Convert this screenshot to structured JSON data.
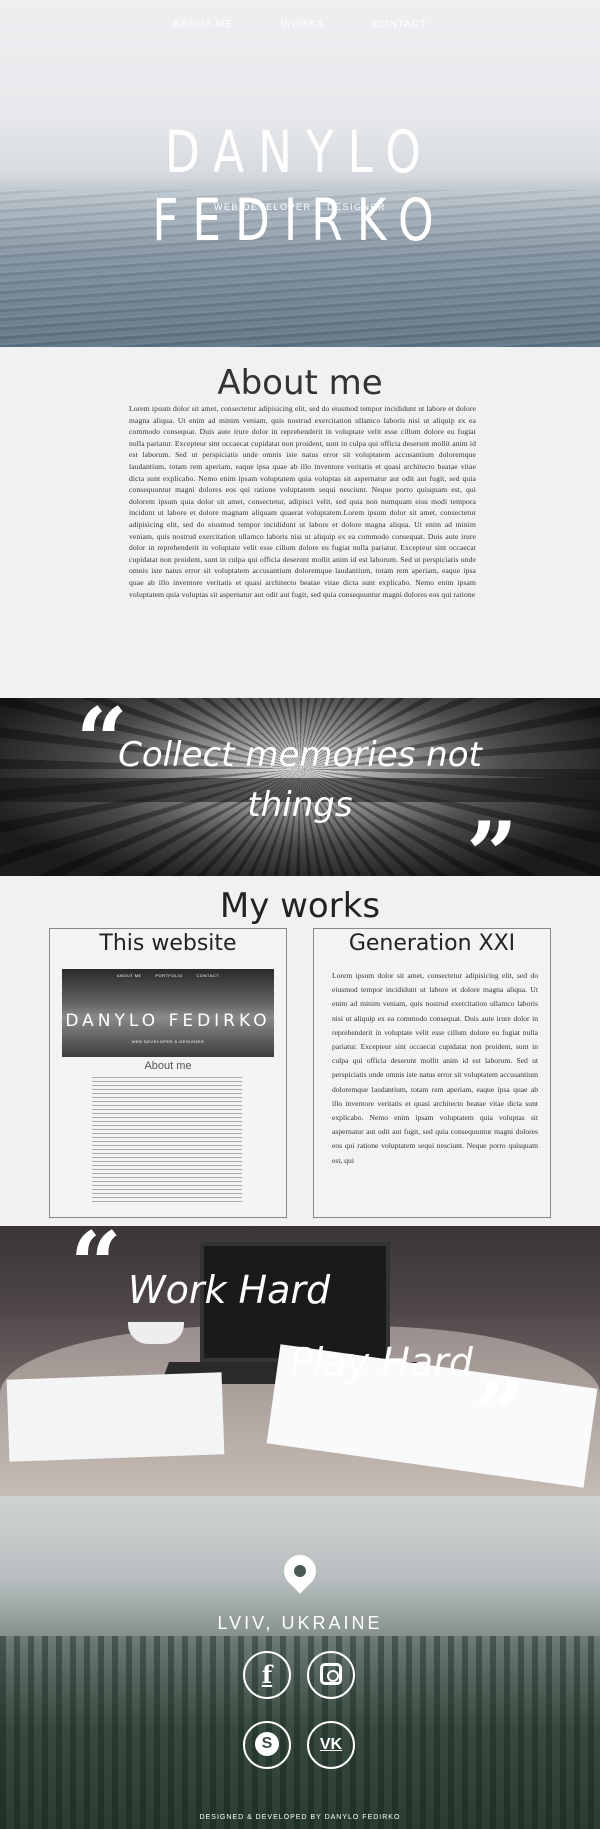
{
  "nav": {
    "about": "ABOUT ME",
    "works": "WORKS",
    "contact": "CONTACT"
  },
  "hero": {
    "title": "DANYLO FEDIRKO",
    "subtitle": "WEB DEVELOPER & DESIGNER"
  },
  "about": {
    "heading": "About me",
    "text": "Lorem ipsum dolor sit amet, consectetur adipisicing elit, sed do eiusmod tempor incididunt ut labore et dolore magna aliqua. Ut enim ad minim veniam, quis nostrud exercitation ullamco laboris nisi ut aliquip ex ea commodo consequat. Duis aute irure dolor in reprehenderit in voluptate velit esse cillum dolore eu fugiat nulla pariatur. Excepteur sint occaecat cupidatat non proident, sunt in culpa qui officia deserunt mollit anim id est laborum. Sed ut perspiciatis unde omnis iste natus error sit voluptatem accusantium doloremque laudantium, totam rem aperiam, eaque ipsa quae ab illo inventore veritatis et quasi architecto beatae vitae dicta sunt explicabo. Nemo enim ipsam voluptatem quia voluptas sit aspernatur aut odit aut fugit, sed quia consequuntur magni dolores eos qui ratione voluptatem sequi nesciunt. Neque porro quisquam est, qui dolorem ipsum quia dolor sit amet, consectetur, adipisci velit, sed quia non numquam eius modi tempora incidunt ut labore et dolore magnam aliquam quaerat voluptatem.Lorem ipsum dolor sit amet, consectetur adipisicing elit, sed do eiusmod tempor incididunt ut labore et dolore magna aliqua. Ut enim ad minim veniam, quis nostrud exercitation ullamco laboris nisi ut aliquip ex ea commodo consequat. Duis aute irure dolor in reprehenderit in voluptate velit esse cillum dolore eu fugiat nulla pariatur. Excepteur sint occaecat cupidatat non proident, sunt in culpa qui officia deserunt mollit anim id est laborum. Sed ut perspiciatis unde omnis iste natus error sit voluptatem accusantium doloremque laudantium, totam rem aperiam, eaque ipsa quae ab illo inventore veritatis et quasi architecto beatae vitae dicta sunt explicabo. Nemo enim ipsam voluptatem quia voluptas sit aspernatur aut odit aut fugit, sed quia consequuntur magni dolores eos qui ratione"
  },
  "quote1": {
    "line1": "Collect memories not",
    "line2": "things",
    "open": "“",
    "close": "”"
  },
  "works": {
    "heading": "My works",
    "card1": {
      "title": "This website",
      "thumb_nav": [
        "ABOUT ME",
        "PORTFOLIO",
        "CONTACT"
      ],
      "thumb_title": "DANYLO FEDIRKO",
      "thumb_subtitle": "WEB DEVELOPER & DESIGNER",
      "thumb_about": "About me"
    },
    "card2": {
      "title": "Generation XXI",
      "text": "Lorem ipsum dolor sit amet, consectetur adipisicing elit, sed do eiusmod tempor incididunt ut labore et dolore magna aliqua. Ut enim ad minim veniam, quis nostrud exercitation ullamco laboris nisi ut aliquip ex ea commodo consequat. Duis aute irure dolor in reprehenderit in voluptate velit esse cillum dolore eu fugiat nulla pariatur. Excepteur sint occaecat cupidatat non proident, sunt in culpa qui officia deserunt mollit anim id est laborum. Sed ut perspiciatis unde omnis iste natus error sit voluptatem accusantium doloremque laudantium, totam rem aperiam, eaque ipsa quae ab illo inventore veritatis et quasi architecto beatae vitae dicta sunt explicabo. Nemo enim ipsam voluptatem quia voluptas sit aspernatur aut odit aut fugit, sed quia consequuntur magni dolores eos qui ratione voluptatem sequi nesciunt. Neque porro quisquam est, qui"
    }
  },
  "quote2": {
    "line1": "Work Hard",
    "line2": "Play Hard",
    "open": "“",
    "close": "”"
  },
  "footer": {
    "location": "LVIV, UKRAINE",
    "social_icons": [
      "facebook-icon",
      "instagram-icon",
      "skype-icon",
      "vk-icon"
    ],
    "facebook_glyph": "f",
    "skype_glyph": "S",
    "vk_glyph": "VK",
    "credit": "DESIGNED & DEVELOPED BY DANYLO FEDIRKO"
  }
}
